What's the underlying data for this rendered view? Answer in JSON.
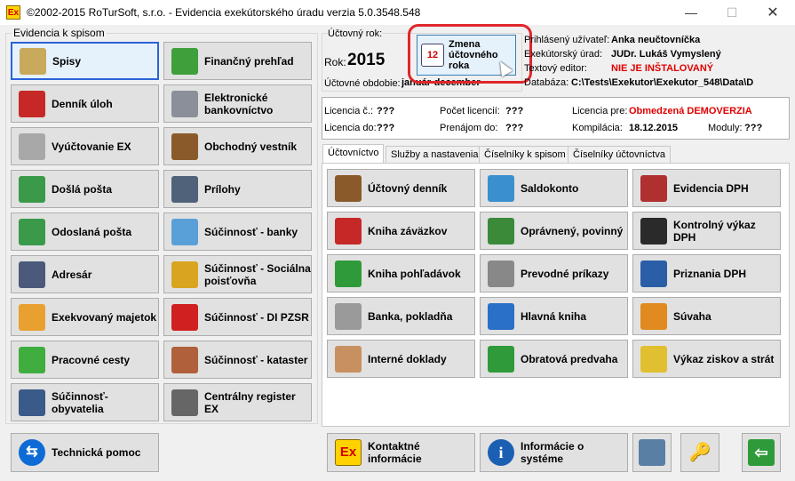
{
  "window": {
    "title": "©2002-2015 RoTurSoft, s.r.o. - Evidencia exekútorského úradu verzia 5.0.3548.548",
    "icon_text": "Ex",
    "minimize": "—",
    "maximize": "☐",
    "close": "✕"
  },
  "left_group": {
    "label": "Evidencia k spisom",
    "buttons": [
      {
        "label": "Spisy",
        "icon": "folder-stack-icon"
      },
      {
        "label": "Finančný prehľad",
        "icon": "pie-chart-icon"
      },
      {
        "label": "Denník úloh",
        "icon": "calendar-icon"
      },
      {
        "label": "Elektronické\nbankovníctvo",
        "icon": "bank-building-icon"
      },
      {
        "label": "Vyúčtovanie EX",
        "icon": "coins-icon"
      },
      {
        "label": "Obchodný vestník",
        "icon": "gavel-icon"
      },
      {
        "label": "Došlá pošta",
        "icon": "envelope-in-icon"
      },
      {
        "label": "Prílohy",
        "icon": "scanner-icon"
      },
      {
        "label": "Odoslaná pošta",
        "icon": "envelope-out-icon"
      },
      {
        "label": "Súčinnosť - banky",
        "icon": "piggy-bank-icon"
      },
      {
        "label": "Adresár",
        "icon": "address-book-icon"
      },
      {
        "label": "Súčinnosť - Sociálna\npoisťovňa",
        "icon": "worker-icon"
      },
      {
        "label": "Exekvovaný majetok",
        "icon": "picture-icon"
      },
      {
        "label": "Súčinnosť - DI PZSR",
        "icon": "red-car-icon"
      },
      {
        "label": "Pracovné cesty",
        "icon": "green-car-icon"
      },
      {
        "label": "Súčinnosť - kataster",
        "icon": "houses-icon"
      },
      {
        "label": "Súčinnosť- obyvatelia",
        "icon": "person-binoculars-icon"
      },
      {
        "label": "Centrálny register EX",
        "icon": "spider-web-icon"
      }
    ],
    "support_button": {
      "label": "Technická pomoc",
      "icon": "teamviewer-icon"
    }
  },
  "accounting_year": {
    "label": "Účtovný rok:",
    "year_label": "Rok:",
    "year_value": "2015",
    "period_label": "Účtovné obdobie:",
    "period_value": "január-december",
    "change_button": "Zmena\núčtovného\nroka"
  },
  "user_info": {
    "rows": [
      {
        "label": "Prihlásený užívateľ:",
        "value": "Anka neučtovníčka",
        "style": "bold"
      },
      {
        "label": "Exekútorský úrad:",
        "value": "JUDr. Lukáš Vymyslený",
        "style": "normal"
      },
      {
        "label": "Textový editor:",
        "value": "NIE JE INŠTALOVANÝ",
        "style": "red"
      },
      {
        "label": "Databáza:",
        "value": "C:\\Tests\\Exekutor\\Exekutor_548\\Data\\D",
        "style": "normal"
      }
    ]
  },
  "license": {
    "number_label": "Licencia č.:",
    "number_value": "???",
    "count_label": "Počet licencií:",
    "count_value": "???",
    "for_label": "Licencia pre:",
    "for_value": "Obmedzená DEMOVERZIA",
    "until_label": "Licencia do:",
    "until_value": "???",
    "login_label": "Prenájom do:",
    "login_value": "???",
    "compile_label": "Kompilácia:",
    "compile_value": "18.12.2015",
    "modules_label": "Moduly:",
    "modules_value": "???"
  },
  "tabs": [
    "Účtovníctvo",
    "Služby a nastavenia",
    "Číselníky k spisom",
    "Číselníky účtovníctva"
  ],
  "accounting_buttons": [
    {
      "label": "Účtovný denník",
      "icon": "chest-icon"
    },
    {
      "label": "Saldokonto",
      "icon": "chart-window-icon"
    },
    {
      "label": "Evidencia DPH",
      "icon": "store-icon"
    },
    {
      "label": "Kniha záväzkov",
      "icon": "book-arrow-in-icon"
    },
    {
      "label": "Oprávnený, povinný",
      "icon": "two-people-icon"
    },
    {
      "label": "Kontrolný výkaz DPH",
      "icon": "black-binder-icon"
    },
    {
      "label": "Kniha pohľadávok",
      "icon": "book-arrow-out-icon"
    },
    {
      "label": "Prevodné príkazy",
      "icon": "bank-transfer-icon"
    },
    {
      "label": "Priznania DPH",
      "icon": "blue-binder-icon"
    },
    {
      "label": "Banka, pokladňa",
      "icon": "money-stack-icon"
    },
    {
      "label": "Hlavná kniha",
      "icon": "blue-book-icon"
    },
    {
      "label": "Súvaha",
      "icon": "orange-binder-icon"
    },
    {
      "label": "Interné doklady",
      "icon": "hand-document-icon"
    },
    {
      "label": "Obratová predvaha",
      "icon": "green-book-icon"
    },
    {
      "label": "Výkaz ziskov a strát",
      "icon": "yellow-binder-icon"
    }
  ],
  "bottom_buttons": {
    "contact": {
      "label": "Kontaktné informácie",
      "icon": "ex-logo-icon",
      "icon_text": "Ex"
    },
    "system": {
      "label": "Informácie o systéme",
      "icon": "info-icon",
      "icon_text": "i"
    }
  },
  "icon_glyphs": {
    "keys": "🔑",
    "exit": "⇦"
  },
  "colors": {
    "highlight": "#e0262b",
    "red_text": "#e00000",
    "focus": "#2a63d8"
  }
}
